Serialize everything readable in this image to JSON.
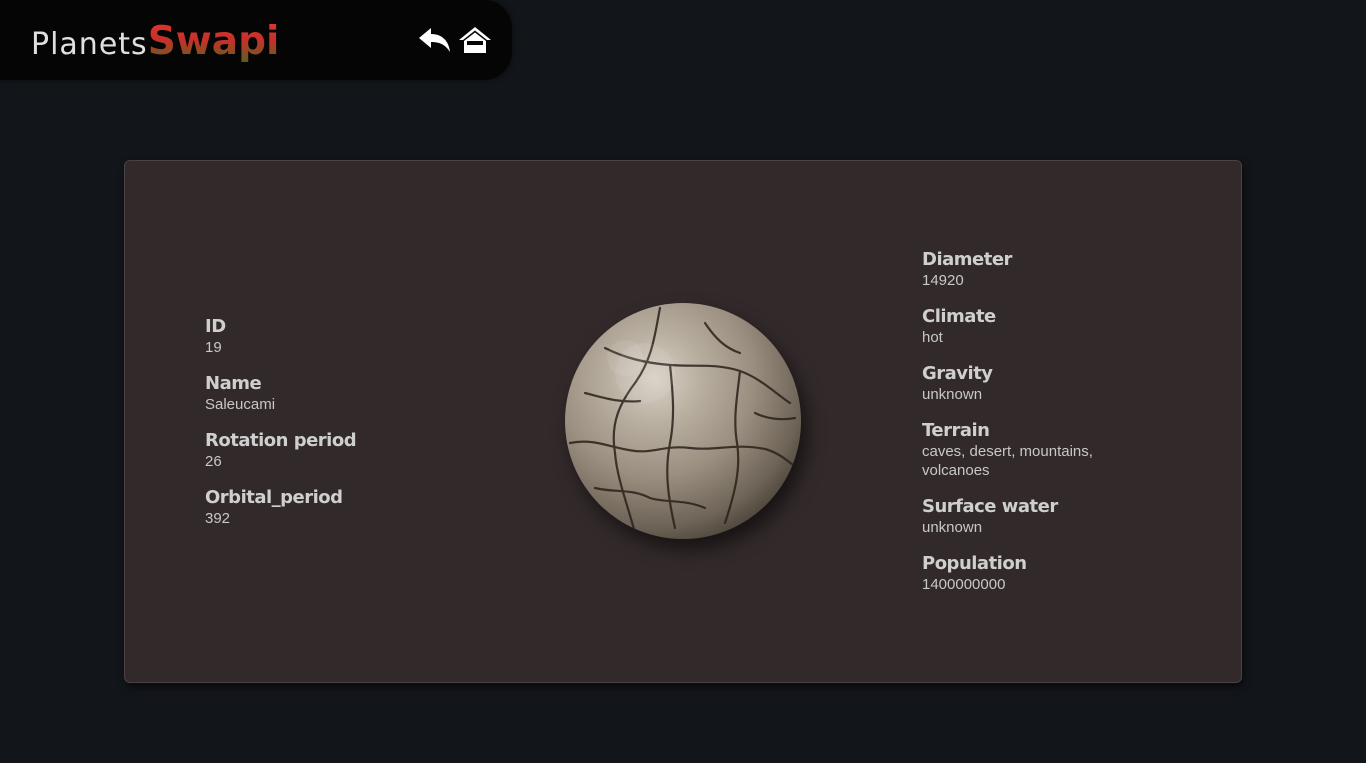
{
  "header": {
    "logo_part1": "Planets",
    "logo_part2": "Swapi",
    "back_icon": "reply-arrow-icon",
    "home_icon": "home-icon"
  },
  "planet": {
    "left_fields": [
      {
        "label": "ID",
        "value": "19"
      },
      {
        "label": "Name",
        "value": "Saleucami"
      },
      {
        "label": "Rotation period",
        "value": "26"
      },
      {
        "label": "Orbital_period",
        "value": "392"
      }
    ],
    "right_fields": [
      {
        "label": "Diameter",
        "value": "14920"
      },
      {
        "label": "Climate",
        "value": "hot"
      },
      {
        "label": "Gravity",
        "value": "unknown"
      },
      {
        "label": "Terrain",
        "value": "caves, desert, mountains, volcanoes"
      },
      {
        "label": "Surface water",
        "value": "unknown"
      },
      {
        "label": "Population",
        "value": "1400000000"
      }
    ]
  },
  "colors": {
    "page_bg": "#12151a",
    "header_bg": "#050505",
    "card_bg": "#32292a",
    "logo_accent": "#c9302a"
  }
}
